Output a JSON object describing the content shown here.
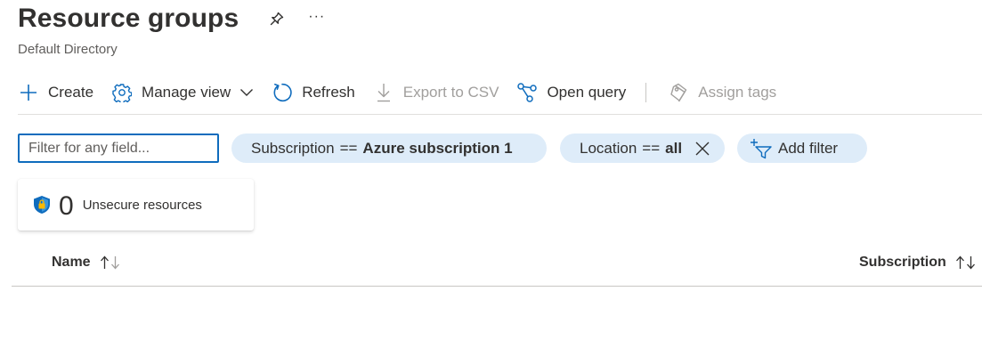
{
  "header": {
    "title": "Resource groups",
    "subtitle": "Default Directory",
    "more_label": "···"
  },
  "toolbar": {
    "create_label": "Create",
    "manage_view_label": "Manage view",
    "refresh_label": "Refresh",
    "export_csv_label": "Export to CSV",
    "open_query_label": "Open query",
    "assign_tags_label": "Assign tags"
  },
  "filters": {
    "search_placeholder": "Filter for any field...",
    "search_value": "",
    "subscription_key": "Subscription",
    "subscription_op": "==",
    "subscription_value": "Azure subscription 1",
    "location_key": "Location",
    "location_op": "==",
    "location_value": "all",
    "add_filter_label": "Add filter"
  },
  "summary_card": {
    "count": "0",
    "label": "Unsecure resources"
  },
  "table": {
    "columns": [
      {
        "label": "Name",
        "sort": "ascending"
      },
      {
        "label": "Subscription",
        "sort": "none"
      }
    ],
    "rows": []
  },
  "colors": {
    "accent": "#0f6cbd",
    "pill_bg": "#deecf9",
    "text": "#323130",
    "disabled": "#a19f9d"
  }
}
